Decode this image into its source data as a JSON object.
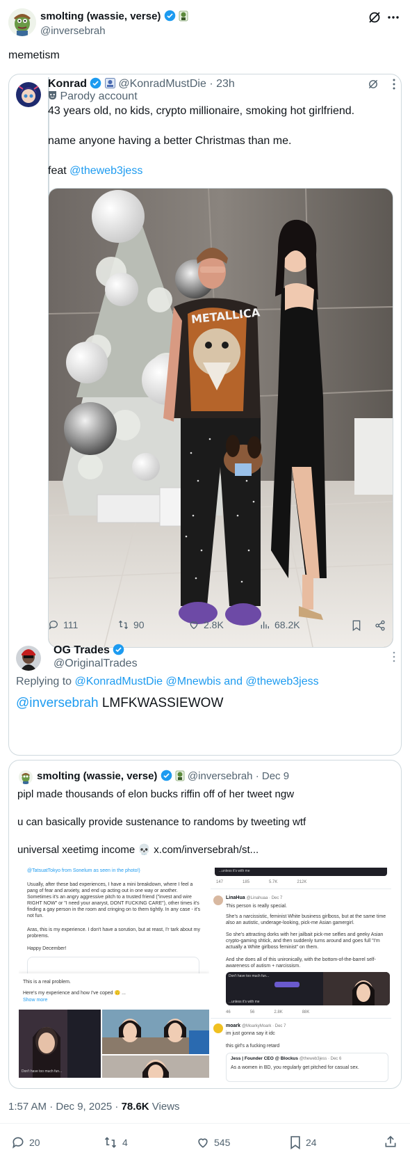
{
  "post": {
    "author_name": "smolting (wassie, verse)",
    "handle": "@inversebrah",
    "text": "memetism",
    "time": "1:57 AM · Dec 9, 2025 · ",
    "views_count": "78.6K",
    "views_label": " Views",
    "actions": {
      "reply": "20",
      "repost": "4",
      "like": "545",
      "bookmark": "24"
    }
  },
  "quote": {
    "konrad": {
      "name": "Konrad",
      "handle": "@KonradMustDie",
      "time": "· 23h",
      "parody": "Parody account",
      "line1": "43 years old, no kids, crypto millionaire, smoking hot girlfriend.",
      "line2": "name anyone having a better Christmas than me.",
      "feat_prefix": "feat ",
      "feat_mention": "@theweb3jess",
      "photo_band_text": "METALLICA",
      "stats": {
        "reply": "111",
        "repost": "90",
        "like": "2.8K",
        "views": "68.2K"
      }
    },
    "og": {
      "name": "OG Trades",
      "handle": "@OriginalTrades",
      "replying_prefix": "Replying to ",
      "replying_mentions": "@KonradMustDie @Mnewbis and @theweb3jess",
      "mention": "@inversebrah",
      "text": " LMFKWASSIEWOW"
    }
  },
  "quote2": {
    "name": "smolting (wassie, verse)",
    "handle": "@inversebrah",
    "time": "· Dec 9",
    "line1": "pipl made thousands of elon bucks riffin off of her tweet ngw",
    "line2": "u can basically provide sustenance to randoms by tweeting wtf",
    "line3_prefix": "universal xeetimg income ",
    "line3_emoji": "💀",
    "line3_link": " x.com/inversebrah/st...",
    "left_shot": {
      "top": "@TatsuatTokyo from Sonelum as seen in the photo!)",
      "p1": "Usually, after these bad experiences, I have a mini breakdown, where I feel a pang of fear and anxiety, and end up acting out in one way or another. Sometimes it's an angry aggressive pitch to a trusted friend (\"invest and wire RIGHT NOW\" or \"I need your anaryst, DONT FUCKING CARE\"), other times it's finding a gay person in the room and cringing on to them tightly. In any case - it's not fun.",
      "p2": "Aras, this is my experience. I don't have a sorution, but at reast, I'r tark about my probrems.",
      "p3": "Happy December!",
      "inset1": "This is a real problem.",
      "inset2": "Here's my experience and how I've coped 🙃 ...",
      "inset3": "Show more",
      "caption": "Don't have too much fun..."
    },
    "right_shot": {
      "unless": "...unless it's with me",
      "stats1": [
        "147",
        "185",
        "5.7K",
        "212K"
      ],
      "lina_name": "LinaHua",
      "lina_handle": "@Linahuaa · Dec 7",
      "lina_p1": "This person is really special.",
      "lina_p2": "She's a narcissistic, feminist White business girlboss, but at the same time also an autistic, underage-looking, pick-me Asian gamergirl.",
      "lina_p3": "So she's attracting dorks with her jailbait pick-me selfies and geeky Asian crypto-gaming shtick, and then suddenly turns around and goes full \"I'm actually a White girlboss feminist\" on them.",
      "lina_p4": "And she does all of this unironically, with the bottom-of-the-barrel self-awareness of autism + narcissism.",
      "card_caption": "Don't have too much fun...",
      "card_unless": "...unless it's with me",
      "stats2": [
        "46",
        "56",
        "2.8K",
        "88K"
      ],
      "moark_name": "moark",
      "moark_handle": "@MoarkyMoark · Dec 7",
      "moark_l1": "im just gonna say it idc",
      "moark_l2": "this girl's a fucking retard",
      "jess_name": "Jess | Founder CEO @ Blockus",
      "jess_handle": "@theweb3jess · Dec 6",
      "jess_text": "As a women in BD, you regularly get pitched for casual sex."
    }
  },
  "colors": {
    "accent": "#1d9bf0",
    "text": "#0f1419",
    "muted": "#536471",
    "border": "#cfd9de"
  }
}
